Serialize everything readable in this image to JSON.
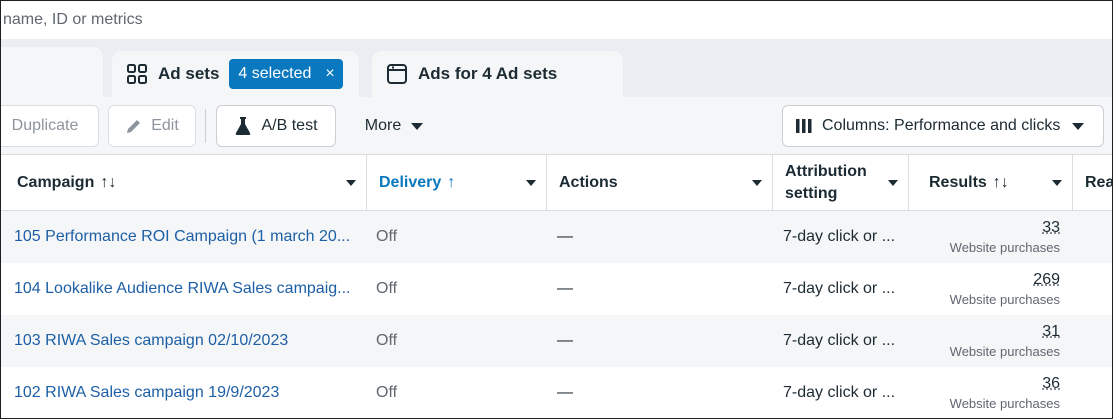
{
  "search": {
    "placeholder": "name, ID or metrics"
  },
  "tabs": {
    "adsets": {
      "label": "Ad sets",
      "selected_label": "4 selected",
      "close": "×"
    },
    "ads": {
      "label": "Ads for 4 Ad sets"
    }
  },
  "toolbar": {
    "duplicate": "Duplicate",
    "edit": "Edit",
    "abtest": "A/B test",
    "more": "More",
    "columns": "Columns: Performance and clicks"
  },
  "table": {
    "headers": {
      "campaign": "Campaign",
      "campaign_sort": "↑↓",
      "delivery": "Delivery",
      "delivery_sort": "↑",
      "actions": "Actions",
      "attribution": "Attribution\nsetting",
      "results": "Results",
      "results_sort": "↑↓",
      "reach": "Rea"
    },
    "rows": [
      {
        "name": "105 Performance ROI Campaign (1 march 20...",
        "delivery": "Off",
        "actions": "—",
        "attribution": "7-day click or ...",
        "results": "33",
        "results_sub": "Website purchases"
      },
      {
        "name": "104 Lookalike Audience RIWA Sales campaig...",
        "delivery": "Off",
        "actions": "—",
        "attribution": "7-day click or ...",
        "results": "269",
        "results_sub": "Website purchases"
      },
      {
        "name": "103 RIWA Sales campaign 02/10/2023",
        "delivery": "Off",
        "actions": "—",
        "attribution": "7-day click or ...",
        "results": "31",
        "results_sub": "Website purchases"
      },
      {
        "name": "102 RIWA Sales campaign 19/9/2023",
        "delivery": "Off",
        "actions": "—",
        "attribution": "7-day click or ...",
        "results": "36",
        "results_sub": "Website purchases"
      }
    ]
  },
  "colors": {
    "accent": "#0a78be",
    "link": "#1d5fa6",
    "muted": "#606770"
  }
}
